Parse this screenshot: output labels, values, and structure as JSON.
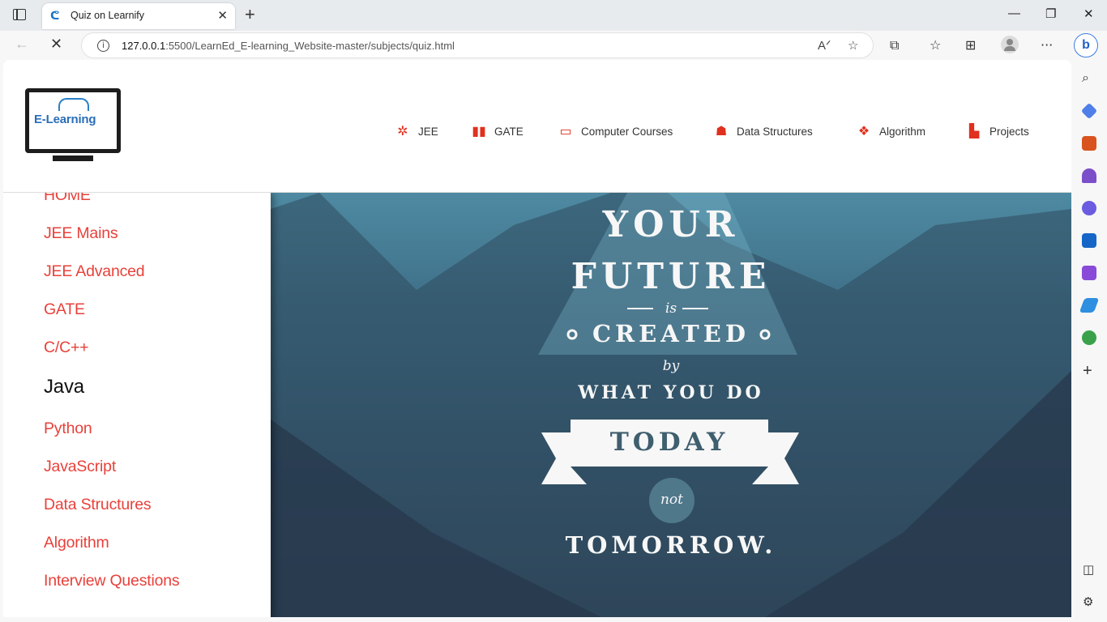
{
  "browser": {
    "tab_title": "Quiz on Learnify",
    "url_host": "127.0.0.1",
    "url_path": ":5500/LearnEd_E-learning_Website-master/subjects/quiz.html",
    "icons": [
      "tab-strip-icon",
      "close-icon",
      "plus-icon",
      "back-arrow-icon",
      "stop-icon",
      "info-icon",
      "read-aloud-icon",
      "favorite-add-icon",
      "extensions-icon",
      "favorites-icon",
      "collections-icon",
      "profile-icon",
      "more-icon",
      "bing-icon"
    ]
  },
  "header": {
    "logo_text": "E-Learning",
    "nav": [
      {
        "label": "JEE",
        "icon": "atom-icon"
      },
      {
        "label": "GATE",
        "icon": "book-icon"
      },
      {
        "label": "Computer Courses",
        "icon": "laptop-icon"
      },
      {
        "label": "Data Structures",
        "icon": "tree-icon"
      },
      {
        "label": "Algorithm",
        "icon": "cubes-icon"
      },
      {
        "label": "Projects",
        "icon": "dashboard-icon"
      }
    ]
  },
  "sidebar": {
    "items": [
      {
        "label": "HOME"
      },
      {
        "label": "JEE Mains"
      },
      {
        "label": "JEE Advanced"
      },
      {
        "label": "GATE"
      },
      {
        "label": "C/C++"
      },
      {
        "label": "Java",
        "active": true
      },
      {
        "label": "Python"
      },
      {
        "label": "JavaScript"
      },
      {
        "label": "Data Structures"
      },
      {
        "label": "Algorithm"
      },
      {
        "label": "Interview Questions"
      }
    ]
  },
  "hero": {
    "line1": "YOUR",
    "line2": "FUTURE",
    "line3": "is",
    "line4": "CREATED",
    "line5": "by",
    "line6": "WHAT YOU DO",
    "line7": "TODAY",
    "line8": "not",
    "line9": "TOMORROW."
  },
  "colors": {
    "accent": "#e8413a",
    "nav_icon": "#e0301e",
    "hero_dark": "#2e3f53"
  }
}
